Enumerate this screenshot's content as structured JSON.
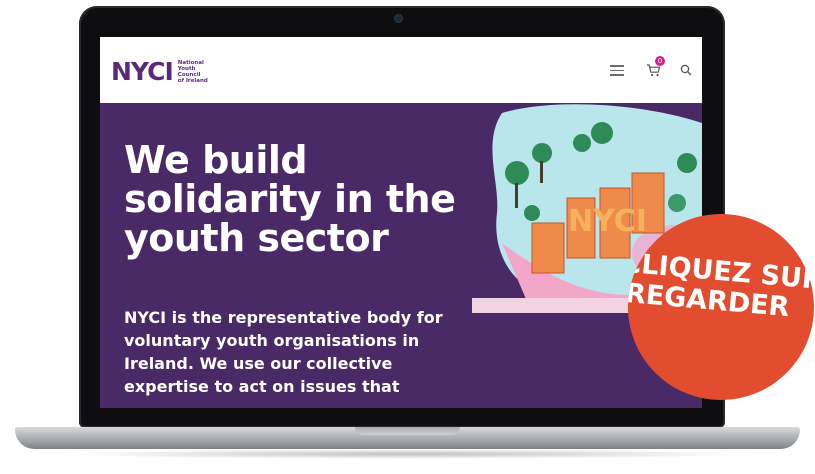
{
  "site": {
    "logo": {
      "mark": "NYCI",
      "sub": [
        "National",
        "Youth",
        "Council",
        "of Ireland"
      ]
    },
    "cart_count": "0"
  },
  "hero": {
    "title": "We build solidarity in the youth sector",
    "body": "NYCI is the representative body for voluntary youth organisations in Ireland. We use our collective expertise to act on issues that",
    "illustration_text": "NYCI"
  },
  "cta": {
    "line1": "CLIQUEZ SUR",
    "line2": "REGARDER"
  },
  "icons": [
    "menu-icon",
    "cart-icon",
    "search-icon"
  ],
  "colors": {
    "brand_purple": "#4a2a66",
    "logo_purple": "#5a2a7a",
    "badge_pink": "#d0248a",
    "cta_orange": "#e24d2f"
  }
}
